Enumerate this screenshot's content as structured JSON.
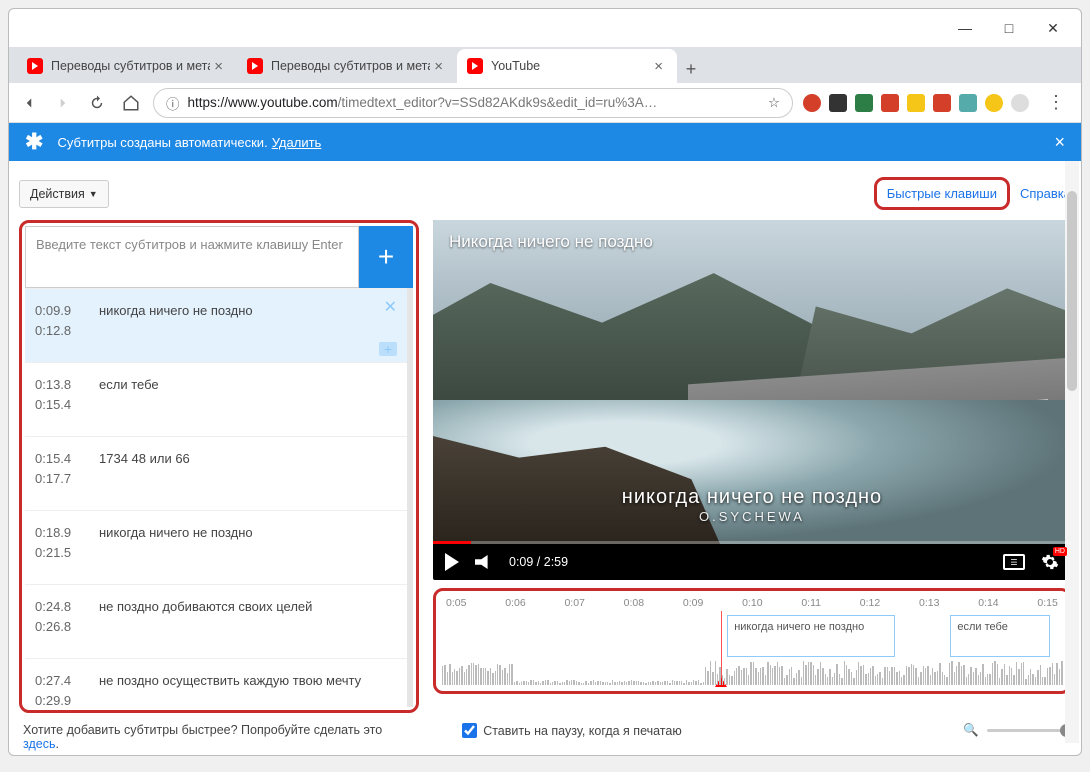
{
  "window": {
    "title": "YouTube"
  },
  "tabs": [
    {
      "title": "Переводы субтитров и метадан",
      "active": false
    },
    {
      "title": "Переводы субтитров и метадан",
      "active": false
    },
    {
      "title": "YouTube",
      "active": true
    }
  ],
  "url": {
    "scheme_icon": "ⓘ",
    "full": "https://www.youtube.com/timedtext_editor?v=SSd82AKdk9s&edit_id=ru%3A…",
    "host": "https://www.youtube.com",
    "path": "/timedtext_editor?v=SSd82AKdk9s&edit_id=ru%3A…"
  },
  "notice": {
    "text": "Субтитры созданы автоматически.",
    "action": "Удалить"
  },
  "toolbar": {
    "actions": "Действия",
    "hotkeys": "Быстрые клавиши",
    "help": "Справка"
  },
  "editor": {
    "placeholder": "Введите текст субтитров и нажмите клавишу Enter",
    "items": [
      {
        "start": "0:09.9",
        "end": "0:12.8",
        "text": "никогда ничего не поздно",
        "selected": true
      },
      {
        "start": "0:13.8",
        "end": "0:15.4",
        "text": "если тебе"
      },
      {
        "start": "0:15.4",
        "end": "0:17.7",
        "text": "1734 48 или 66"
      },
      {
        "start": "0:18.9",
        "end": "0:21.5",
        "text": "никогда ничего не поздно"
      },
      {
        "start": "0:24.8",
        "end": "0:26.8",
        "text": "не поздно добиваются своих целей"
      },
      {
        "start": "0:27.4",
        "end": "0:29.9",
        "text": "не поздно осуществить каждую твою мечту"
      }
    ]
  },
  "video": {
    "title": "Никогда ничего не поздно",
    "overlay_line1": "никогда ничего не поздно",
    "overlay_line2": "O.SYCHEWA",
    "time": "0:09 / 2:59"
  },
  "timeline": {
    "ticks": [
      "0:05",
      "0:06",
      "0:07",
      "0:08",
      "0:09",
      "0:10",
      "0:11",
      "0:12",
      "0:13",
      "0:14",
      "0:15"
    ],
    "clips": [
      {
        "text": "никогда ничего не поздно",
        "left_pct": 46,
        "width_pct": 27
      },
      {
        "text": "если тебе",
        "left_pct": 82,
        "width_pct": 16
      }
    ],
    "playhead_pct": 45
  },
  "footer": {
    "hint_pre": "Хотите добавить субтитры быстрее? Попробуйте сделать это ",
    "hint_link": "здесь",
    "checkbox": "Ставить на паузу, когда я печатаю"
  },
  "ext_colors": [
    "#d43f2a",
    "#333",
    "#2d7",
    "#d43f2a",
    "#f5c518",
    "#d43f2a",
    "#6aa",
    "#f5c518",
    "#ccc"
  ]
}
